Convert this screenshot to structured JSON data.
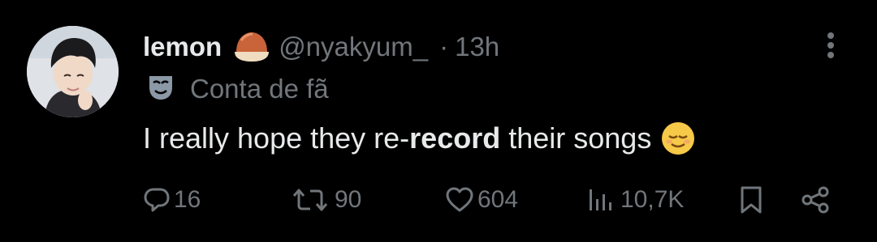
{
  "tweet": {
    "display_name": "lemon",
    "name_emoji": "chestnut-emoji",
    "handle": "@nyakyum_",
    "separator": "·",
    "time": "13h",
    "fan_badge_icon": "theater-masks-icon",
    "fan_label": "Conta de fã",
    "text_before": "I really hope they re-",
    "text_bold": "record",
    "text_after": " their songs",
    "text_emoji": "relieved-face-emoji"
  },
  "actions": {
    "replies": "16",
    "reposts": "90",
    "likes": "604",
    "views": "10,7K"
  },
  "icons": {
    "reply": "reply-icon",
    "repost": "repost-icon",
    "like": "heart-icon",
    "views": "views-icon",
    "bookmark": "bookmark-icon",
    "share": "share-icon",
    "more": "more-icon"
  },
  "colors": {
    "background": "#000000",
    "primary_text": "#e7e9ea",
    "secondary_text": "#71767b"
  }
}
